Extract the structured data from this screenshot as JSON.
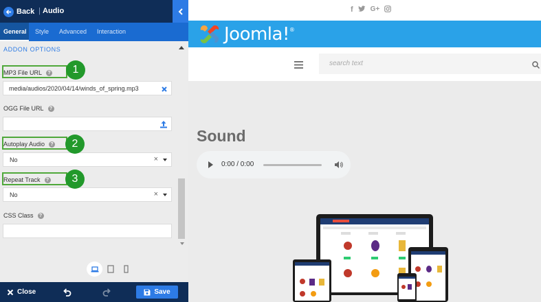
{
  "topbar": {
    "back_label": "Back",
    "title": "Audio"
  },
  "tabs": [
    {
      "label": "General",
      "active": true
    },
    {
      "label": "Style",
      "active": false
    },
    {
      "label": "Advanced",
      "active": false
    },
    {
      "label": "Interaction",
      "active": false
    }
  ],
  "section": {
    "title": "ADDON OPTIONS"
  },
  "fields": {
    "mp3": {
      "label": "MP3 File URL",
      "value": "media/audios/2020/04/14/winds_of_spring.mp3"
    },
    "ogg": {
      "label": "OGG File URL",
      "value": ""
    },
    "autoplay": {
      "label": "Autoplay Audio",
      "value": "No"
    },
    "repeat": {
      "label": "Repeat Track",
      "value": "No"
    },
    "css": {
      "label": "CSS Class",
      "value": ""
    }
  },
  "callouts": [
    "1",
    "2",
    "3"
  ],
  "bottombar": {
    "close_label": "Close",
    "save_label": "Save"
  },
  "preview": {
    "social_icons": [
      "f",
      "twitter-icon",
      "G+",
      "instagram-icon"
    ],
    "logo_text": "Joomla!",
    "search_placeholder": "search text",
    "sound_title": "Sound",
    "player_time": "0:00 / 0:00"
  },
  "colors": {
    "topbar": "#0f2d57",
    "tabs": "#1a6bd1",
    "accent": "#2d7be5",
    "callout": "#22992b",
    "logo_bar": "#2aa2e8"
  }
}
